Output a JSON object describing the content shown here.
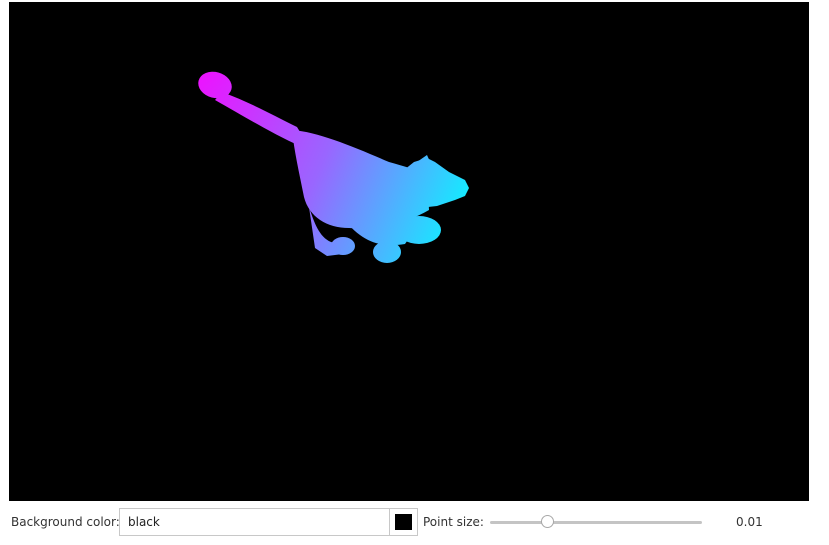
{
  "viewer": {
    "background": "#000000",
    "point_cloud_colors": [
      "#ee11ff",
      "#9966ff",
      "#11eeff"
    ]
  },
  "controls": {
    "background_color_label": "Background color:",
    "background_color_value": "black",
    "background_swatch_color": "#000000",
    "point_size_label": "Point size:",
    "point_size_value": "0.01",
    "point_size_fraction": 0.27
  }
}
